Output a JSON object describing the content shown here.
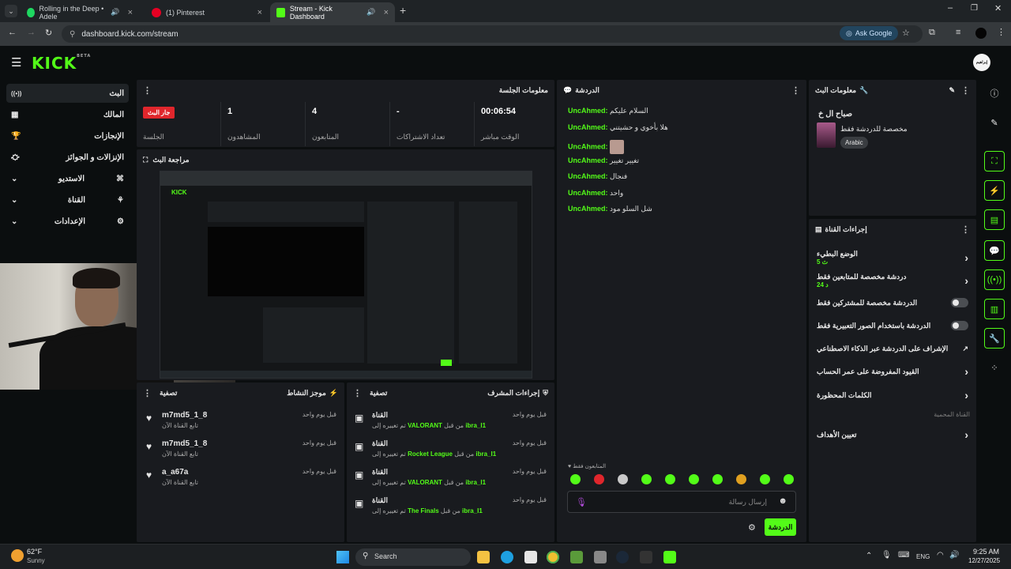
{
  "browser": {
    "tabs": [
      {
        "title": "Rolling in the Deep • Adele",
        "color": "#1ed760"
      },
      {
        "title": "(1) Pinterest",
        "color": "#e60023"
      },
      {
        "title": "Stream - Kick Dashboard",
        "color": "#53fc18"
      }
    ],
    "url": "dashboard.kick.com/stream",
    "ask_google": "Ask Google"
  },
  "header": {
    "logo": "KICK",
    "logo_badge": "BETA",
    "avatar_text": "إبراهيم"
  },
  "sidebar": {
    "items": [
      {
        "label": "البث",
        "icon": "((•))"
      },
      {
        "label": "المالك",
        "icon": "▦"
      },
      {
        "label": "الإنجازات",
        "icon": "🏆"
      },
      {
        "label": "الإنزالات و الجوائز",
        "icon": "⚇"
      },
      {
        "label": "الاستديو",
        "icon": "⌘"
      },
      {
        "label": "القناة",
        "icon": "⚙"
      },
      {
        "label": "الإعدادات",
        "icon": "⚙"
      }
    ]
  },
  "session": {
    "title": "معلومات الجلسة",
    "live_badge": "جار البث",
    "live_label": "الجلسة",
    "viewers_value": "1",
    "viewers_label": "المشاهدون",
    "followers_value": "4",
    "followers_label": "المتابعون",
    "subs_value": "-",
    "subs_label": "تعداد الاشتراكات",
    "time_value": "00:06:54",
    "time_label": "الوقت مباشر"
  },
  "preview": {
    "title": "مراجعة البث"
  },
  "activity": {
    "title": "موجز النشاط",
    "filter": "تصفية",
    "items": [
      {
        "user": "m7md5_1_8",
        "desc": "تابع القناة الآن",
        "time": "قبل يوم واحد"
      },
      {
        "user": "m7md5_1_8",
        "desc": "تابع القناة الآن",
        "time": "قبل يوم واحد"
      },
      {
        "user": "a_a67a",
        "desc": "تابع القناة الآن",
        "time": "قبل يوم واحد"
      }
    ]
  },
  "modactions": {
    "title": "إجراءات المشرف",
    "filter": "تصفية",
    "items": [
      {
        "head": "القناة",
        "prefix": "تم تغييره إلى",
        "value": "VALORANT",
        "by": "من قبل",
        "user": "ibra_I1",
        "time": "قبل يوم واحد"
      },
      {
        "head": "القناة",
        "prefix": "تم تغييره إلى",
        "value": "Rocket League",
        "by": "من قبل",
        "user": "ibra_I1",
        "time": "قبل يوم واحد"
      },
      {
        "head": "القناة",
        "prefix": "تم تغييره إلى",
        "value": "VALORANT",
        "by": "من قبل",
        "user": "ibra_I1",
        "time": "قبل يوم واحد"
      },
      {
        "head": "القناة",
        "prefix": "تم تغييره إلى",
        "value": "The Finals",
        "by": "من قبل",
        "user": "ibra_I1",
        "time": "قبل يوم واحد"
      }
    ]
  },
  "chat": {
    "title": "الدردشة",
    "messages": [
      {
        "user": "UncAhmed:",
        "text": "السلام عليكم"
      },
      {
        "user": "UncAhmed:",
        "text": "هلا بأخوي و حشيتني"
      },
      {
        "user": "UncAhmed:",
        "text": ""
      },
      {
        "user": "UncAhmed:",
        "text": "تغيير تغيير"
      },
      {
        "user": "UncAhmed:",
        "text": "فنجال"
      },
      {
        "user": "UncAhmed:",
        "text": "واحد"
      },
      {
        "user": "UncAhmed:",
        "text": "شل السلو مود"
      }
    ],
    "followers_only": "المتابعون فقط",
    "input_placeholder": "إرسال رسالة",
    "send_label": "الدردشة",
    "emote_colors": [
      "#53fc18",
      "#e0262c",
      "#c9c9c9",
      "#53fc18",
      "#53fc18",
      "#53fc18",
      "#53fc18",
      "#e0a020",
      "#53fc18",
      "#53fc18"
    ]
  },
  "streaminfo": {
    "title": "معلومات البث",
    "stream_title": "صباح ال خ",
    "category": "مخصصة للدردشة فقط",
    "language": "Arabic"
  },
  "channelactions": {
    "title": "إجراءات القناة",
    "slow_mode": "الوضع البطيء",
    "slow_mode_value": "5 ث",
    "followers_chat": "دردشة مخصصة للمتابعين فقط",
    "followers_chat_value": "24 د",
    "subs_chat": "الدردشة مخصصة للمشتركين فقط",
    "emote_chat": "الدردشة باستخدام الصور التعبيرية فقط",
    "ai_mod": "الإشراف على الدردشة عبر الذكاء الاصطناعي",
    "age_limits": "القيود المفروضة على عمر الحساب",
    "banned_words": "الكلمات المحظورة",
    "section_label": "القناة المحمية",
    "goals": "تعيين الأهداف"
  },
  "taskbar": {
    "weather_temp": "62°F",
    "weather_desc": "Sunny",
    "search": "Search",
    "lang": "ENG",
    "time": "9:25 AM",
    "date": "12/27/2025"
  }
}
